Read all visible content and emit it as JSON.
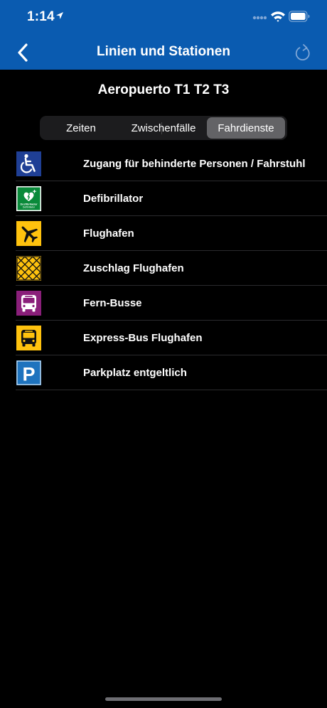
{
  "status_bar": {
    "time": "1:14",
    "icons": [
      "location-arrow-icon",
      "cellular-signal-icon",
      "wifi-icon",
      "battery-icon"
    ]
  },
  "nav": {
    "title": "Linien und Stationen",
    "back_icon": "chevron-left-icon",
    "refresh_icon": "refresh-icon"
  },
  "station": {
    "name": "Aeropuerto T1 T2 T3"
  },
  "segments": {
    "items": [
      "Zeiten",
      "Zwischenfälle",
      "Fahrdienste"
    ],
    "selected": "Fahrdienste"
  },
  "services": [
    {
      "label": "Zugang für behinderte Personen / Fahrstuhl",
      "icon": "wheelchair-icon",
      "color": "#1f3f95"
    },
    {
      "label": "Defibrillator",
      "icon": "defibrillator-icon",
      "color": "#0a8a3a",
      "icon_text": [
        "Desfibrilador",
        "Defibrillator"
      ]
    },
    {
      "label": "Flughafen",
      "icon": "airplane-icon",
      "color": "#ffc20e"
    },
    {
      "label": "Zuschlag Flughafen",
      "icon": "airport-surcharge-icon",
      "color": "#ffc20e"
    },
    {
      "label": "Fern-Busse",
      "icon": "long-distance-bus-icon",
      "color": "#8a1f7a"
    },
    {
      "label": "Express-Bus Flughafen",
      "icon": "express-bus-icon",
      "color": "#ffc20e"
    },
    {
      "label": "Parkplatz entgeltlich",
      "icon": "parking-icon",
      "color": "#1e73be",
      "icon_text": "P"
    }
  ],
  "colors": {
    "header": "#0a5bb0",
    "background": "#000000",
    "segment_selected": "#636366"
  }
}
